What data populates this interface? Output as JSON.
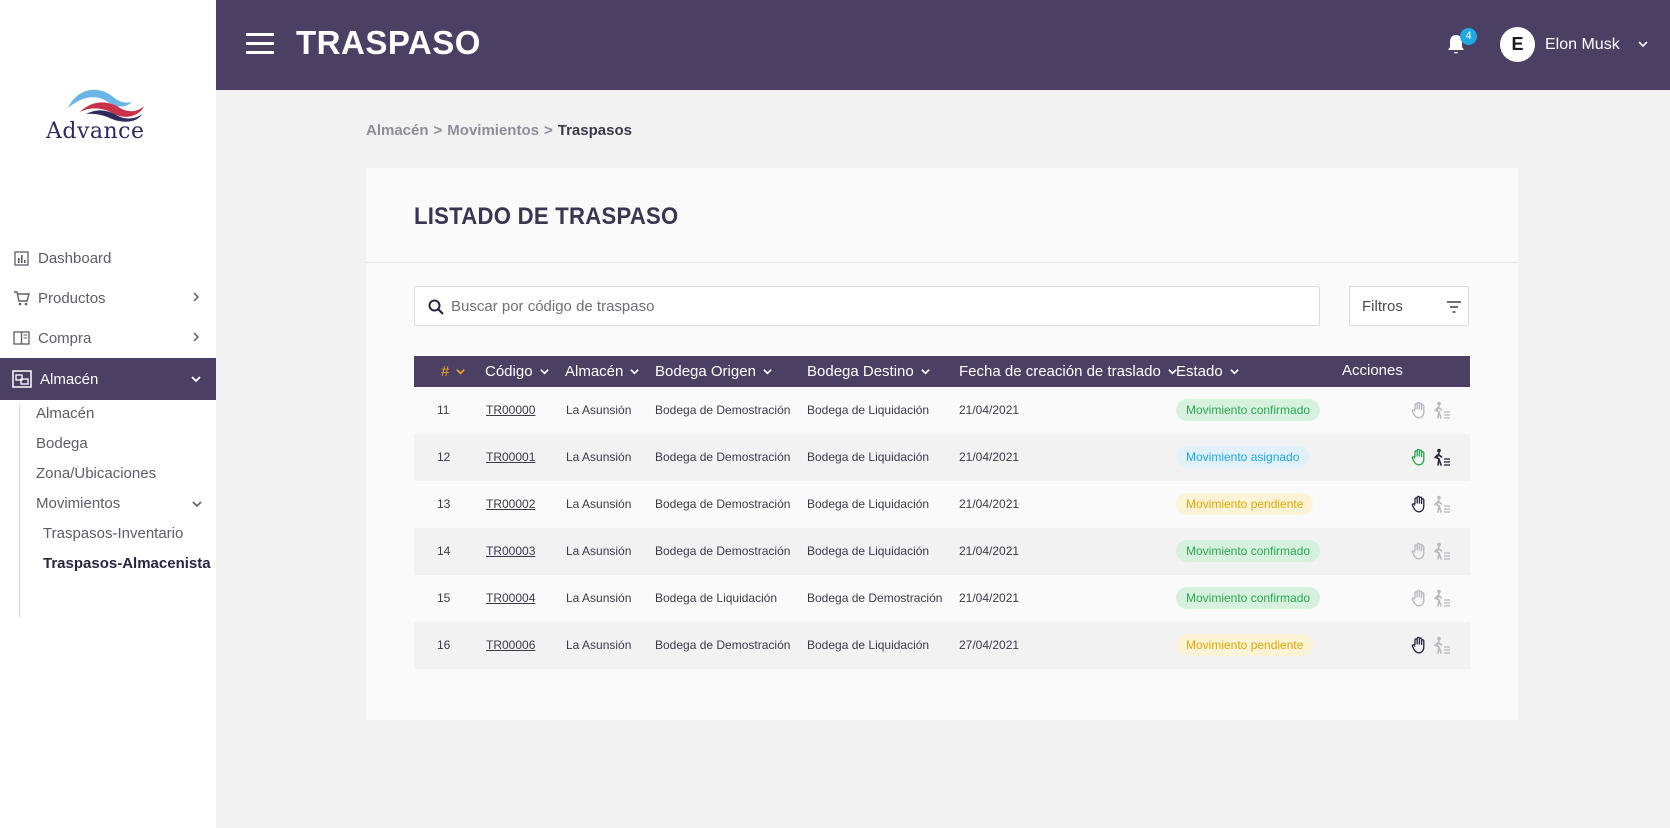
{
  "brand": {
    "logo_text": "Advance"
  },
  "header": {
    "title": "TRASPASO",
    "notifications_count": "4",
    "user_initial": "E",
    "user_name": "Elon Musk"
  },
  "sidebar": {
    "items": [
      {
        "label": "Dashboard",
        "icon": "chart-icon"
      },
      {
        "label": "Productos",
        "icon": "cart-icon"
      },
      {
        "label": "Compra",
        "icon": "book-icon"
      },
      {
        "label": "Almacén",
        "icon": "warehouse-icon"
      }
    ],
    "submenu": [
      "Almacén",
      "Bodega",
      "Zona/Ubicaciones",
      "Movimientos"
    ],
    "subsubmenu": [
      "Traspasos-Inventario",
      "Traspasos-Almacenista"
    ]
  },
  "breadcrumb": {
    "part1": "Almacén",
    "part2": "Movimientos",
    "part3": "Traspasos",
    "separator": ">"
  },
  "card": {
    "title": "LISTADO DE TRASPASO",
    "search_placeholder": "Buscar por código de traspaso",
    "filters_label": "Filtros"
  },
  "table": {
    "headers": [
      "#",
      "Código",
      "Almacén",
      "Bodega Origen",
      "Bodega Destino",
      "Fecha de creación de traslado",
      "Estado",
      "Acciones"
    ],
    "rows": [
      {
        "num": "11",
        "code": "TR00000",
        "almacen": "La Asunsión",
        "origen": "Bodega de Demostración",
        "destino": "Bodega de Liquidación",
        "fecha": "21/04/2021",
        "estado": "Movimiento confirmado",
        "estado_type": "confirmado"
      },
      {
        "num": "12",
        "code": "TR00001",
        "almacen": "La Asunsión",
        "origen": "Bodega de Demostración",
        "destino": "Bodega de Liquidación",
        "fecha": "21/04/2021",
        "estado": "Movimiento asignado",
        "estado_type": "asignado"
      },
      {
        "num": "13",
        "code": "TR00002",
        "almacen": "La Asunsión",
        "origen": "Bodega de Demostración",
        "destino": "Bodega de Liquidación",
        "fecha": "21/04/2021",
        "estado": "Movimiento pendiente",
        "estado_type": "pendiente"
      },
      {
        "num": "14",
        "code": "TR00003",
        "almacen": "La Asunsión",
        "origen": "Bodega de Demostración",
        "destino": "Bodega de Liquidación",
        "fecha": "21/04/2021",
        "estado": "Movimiento confirmado",
        "estado_type": "confirmado"
      },
      {
        "num": "15",
        "code": "TR00004",
        "almacen": "La Asunsión",
        "origen": "Bodega de Liquidación",
        "destino": "Bodega de Demostración",
        "fecha": "21/04/2021",
        "estado": "Movimiento confirmado",
        "estado_type": "confirmado"
      },
      {
        "num": "16",
        "code": "TR00006",
        "almacen": "La Asunsión",
        "origen": "Bodega de Demostración",
        "destino": "Bodega de Liquidación",
        "fecha": "27/04/2021",
        "estado": "Movimiento pendiente",
        "estado_type": "pendiente"
      }
    ]
  },
  "colors": {
    "primary": "#4b3f63",
    "accent_orange": "#f5a623",
    "status_confirmed": "#2aa84f",
    "status_assigned": "#1fa8e0",
    "status_pending": "#e0a800"
  }
}
